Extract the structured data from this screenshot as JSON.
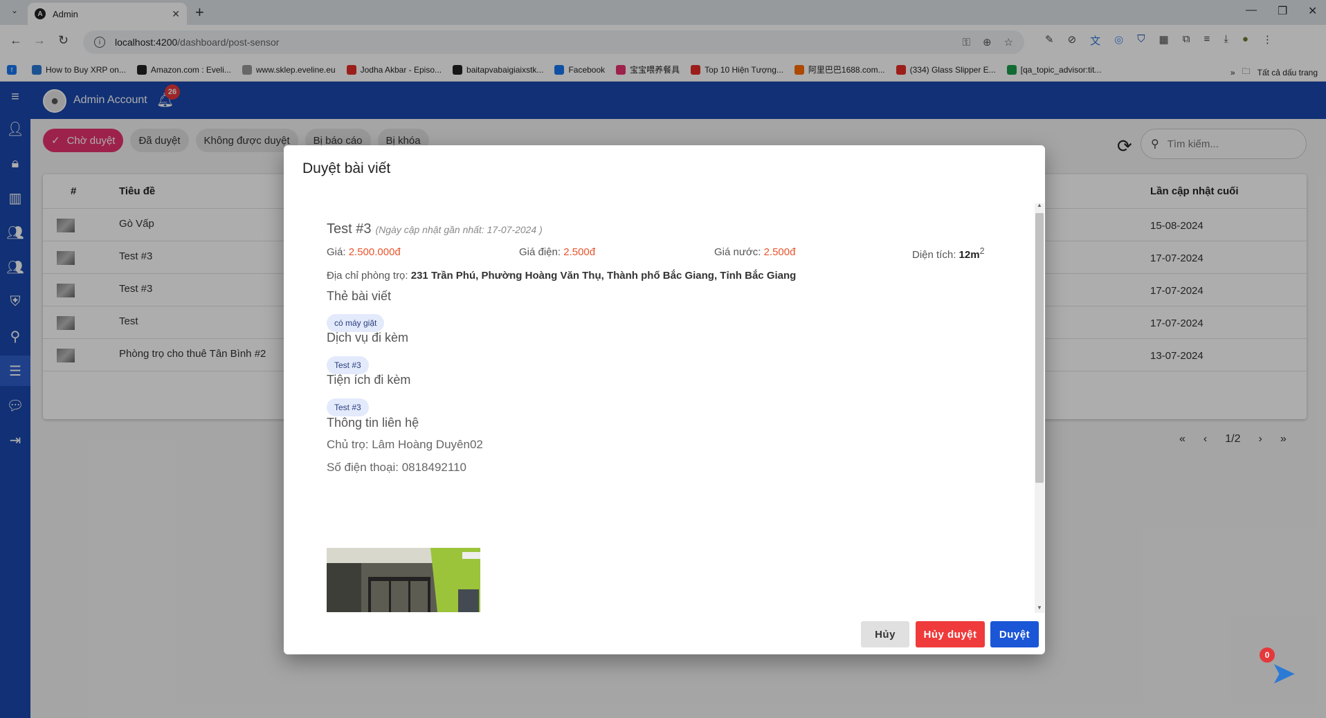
{
  "browser": {
    "tab_title": "Admin",
    "url_host": "localhost:4200",
    "url_path": "/dashboard/post-sensor",
    "bookmarks": [
      {
        "label": "How to Buy XRP on...",
        "color": "#2b7ad6"
      },
      {
        "label": "Amazon.com : Eveli...",
        "color": "#222222"
      },
      {
        "label": "www.sklep.eveline.eu",
        "color": "#999999"
      },
      {
        "label": "Jodha Akbar - Episo...",
        "color": "#e52d27"
      },
      {
        "label": "baitapvabaigiaixstk...",
        "color": "#222222"
      },
      {
        "label": "Facebook",
        "color": "#1877f2"
      },
      {
        "label": "宝宝喂养餐具",
        "color": "#e8336f"
      },
      {
        "label": "Top 10 Hiện Tượng...",
        "color": "#e52d27"
      },
      {
        "label": "阿里巴巴1688.com...",
        "color": "#ff6a00"
      },
      {
        "label": "(334) Glass Slipper E...",
        "color": "#e52d27"
      },
      {
        "label": "[qa_topic_advisor:tit...",
        "color": "#1a9e4a"
      }
    ],
    "more_bookmarks": "»",
    "all_bookmarks": "Tất cả dấu trang"
  },
  "header": {
    "account_name": "Admin Account",
    "notification_count": "26"
  },
  "filters": {
    "chips": [
      {
        "label": "Chờ duyệt",
        "active": true
      },
      {
        "label": "Đã duyệt",
        "active": false
      },
      {
        "label": "Không được duyệt",
        "active": false
      },
      {
        "label": "Bị báo cáo",
        "active": false
      },
      {
        "label": "Bị khóa",
        "active": false
      }
    ],
    "search_placeholder": "Tìm kiếm..."
  },
  "table": {
    "columns": {
      "num": "#",
      "title": "Tiêu đề",
      "updated": "Lần cập nhật cuối"
    },
    "rows": [
      {
        "title": "Gò Vấp",
        "updated": "15-08-2024"
      },
      {
        "title": "Test #3",
        "updated": "17-07-2024"
      },
      {
        "title": "Test #3",
        "updated": "17-07-2024"
      },
      {
        "title": "Test",
        "updated": "17-07-2024"
      },
      {
        "title": "Phòng trọ cho thuê Tân Bình #2",
        "updated": "13-07-2024"
      }
    ],
    "pagination": {
      "first": "«",
      "prev": "‹",
      "page": "1/2",
      "next": "›",
      "last": "»"
    }
  },
  "dialog": {
    "title": "Duyệt bài viết",
    "post_title": "Test #3",
    "updated_note": "(Ngày cập nhật gần nhất: 17-07-2024 )",
    "price_label": "Giá: ",
    "price": "2.500.000đ",
    "electric_label": "Giá điện: ",
    "electric": "2.500đ",
    "water_label": "Giá nước: ",
    "water": "2.500đ",
    "area_label": "Diện tích: ",
    "area": "12m",
    "area_sup": "2",
    "address_label": "Địa chỉ phòng trọ: ",
    "address": "231 Trần Phú, Phường Hoàng Văn Thụ, Thành phố Bắc Giang, Tỉnh Bắc Giang",
    "tags_heading": "Thẻ bài viết",
    "tags": [
      "có máy giặt"
    ],
    "services_heading": "Dịch vụ đi kèm",
    "services": [
      "Test #3"
    ],
    "utilities_heading": "Tiện ích đi kèm",
    "utilities": [
      "Test #3"
    ],
    "contact_heading": "Thông tin liên hệ",
    "owner": "Chủ trọ: Lâm Hoàng Duyên02",
    "phone": "Số điện thoại: 0818492110",
    "buttons": {
      "cancel": "Hủy",
      "reject": "Hủy duyệt",
      "approve": "Duyệt"
    }
  },
  "chat": {
    "unread": "0"
  },
  "colors": {
    "primary": "#1a47ad",
    "accent_pink": "#e8336f",
    "price_orange": "#e8542c",
    "reject_red": "#ef3b3b",
    "approve_blue": "#1b56d6"
  }
}
